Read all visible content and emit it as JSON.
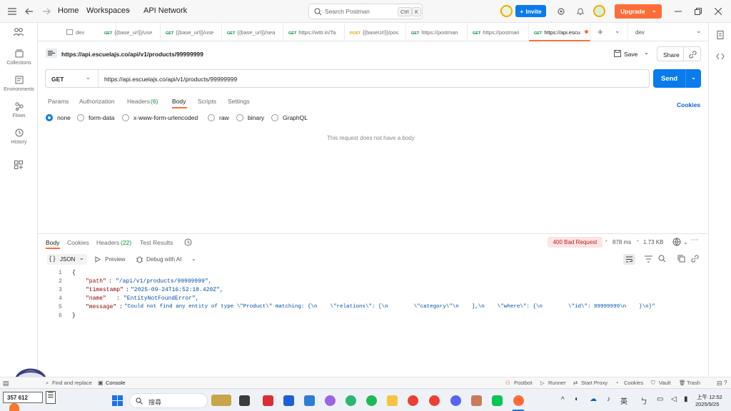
{
  "titlebar": {
    "nav": {
      "home": "Home",
      "workspaces": "Workspaces",
      "api_network": "API Network"
    },
    "search_placeholder": "Search Postman",
    "shortcut_key1": "Ctrl",
    "shortcut_key2": "K",
    "invite_label": "Invite",
    "upgrade_label": "Upgrade"
  },
  "sidebar": {
    "items": [
      {
        "label": "Collections",
        "icon": "collections-icon"
      },
      {
        "label": "Environments",
        "icon": "environments-icon"
      },
      {
        "label": "Flows",
        "icon": "flows-icon"
      },
      {
        "label": "History",
        "icon": "history-icon"
      }
    ]
  },
  "tabs": [
    {
      "method": "",
      "label": "dev"
    },
    {
      "method": "GET",
      "label": "{{base_url}}/use"
    },
    {
      "method": "GET",
      "label": "{{base_url}}/use"
    },
    {
      "method": "GET",
      "label": "{{base_url}}/sea"
    },
    {
      "method": "GET",
      "label": "https://wttr.in/Ta"
    },
    {
      "method": "POST",
      "label": "{{baseUrl}}/pos"
    },
    {
      "method": "GET",
      "label": "https://postman"
    },
    {
      "method": "GET",
      "label": "https://postman"
    },
    {
      "method": "GET",
      "label": "https://api.escu"
    }
  ],
  "env_selector": "dev",
  "request": {
    "title": "https://api.escuelajs.co/api/v1/products/99999999",
    "save_label": "Save",
    "share_label": "Share",
    "method": "GET",
    "url": "https://api.escuelajs.co/api/v1/products/99999999",
    "send_label": "Send",
    "subtabs": [
      "Params",
      "Authorization",
      "Headers",
      "(6)",
      "Body",
      "Scripts",
      "Settings"
    ],
    "cookies_label": "Cookies",
    "body_types": [
      "none",
      "form-data",
      "x-www-form-urlencoded",
      "raw",
      "binary",
      "GraphQL"
    ],
    "empty_body_message": "This request does not have a body"
  },
  "response": {
    "tabs": [
      "Body",
      "Cookies",
      "Headers",
      "(22)",
      "Test Results"
    ],
    "status": "400 Bad Request",
    "time": "878 ms",
    "size": "1.73 KB",
    "format": "JSON",
    "preview_label": "Preview",
    "debug_label": "Debug with AI",
    "code_lines": [
      {
        "n": "1",
        "text": "{"
      },
      {
        "n": "2",
        "key": "\"path\"",
        "val": "\"/api/v1/products/99999999\","
      },
      {
        "n": "3",
        "key": "\"timestamp\"",
        "val": "\"2025-09-24T16:52:18.420Z\","
      },
      {
        "n": "4",
        "key": "\"name\"",
        "val": "\"EntityNotFoundError\","
      },
      {
        "n": "5",
        "key": "\"message\"",
        "val": "\"Could not find any entity of type \\\"Product\\\" matching: {\\n    \\\"relations\\\": [\\n        \\\"category\\\"\\n    ],\\n    \\\"where\\\": {\\n        \\\"id\\\": 99999999\\n    }\\n}\""
      },
      {
        "n": "6",
        "text": "}"
      }
    ]
  },
  "statusbar": {
    "find_replace": "Find and replace",
    "console": "Console",
    "postbot": "Postbot",
    "runner": "Runner",
    "start_proxy": "Start Proxy",
    "cookies": "Cookies",
    "vault": "Vault",
    "trash": "Trash"
  },
  "taskbar": {
    "counter": "357 612",
    "search_label": "搜尋",
    "ime": "英",
    "time": "上午 12:52",
    "date": "2025/9/25"
  },
  "colors": {
    "accent": "#ff6c37",
    "primary": "#097bed",
    "error": "#b72020"
  }
}
